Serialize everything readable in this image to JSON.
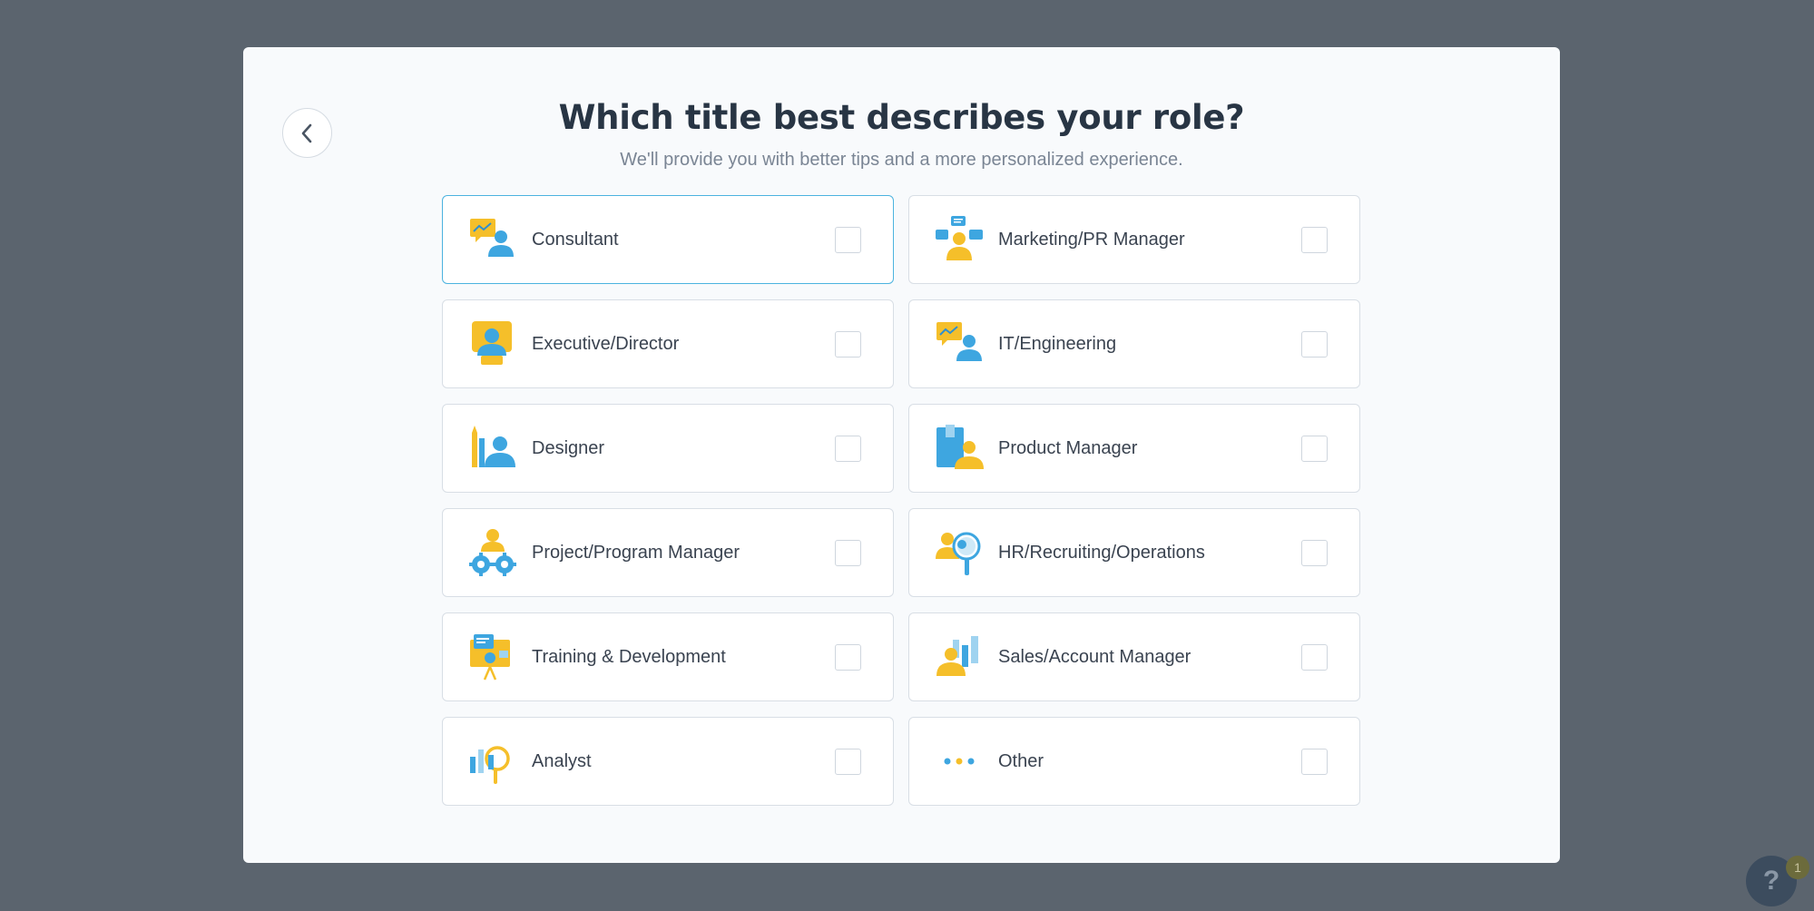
{
  "modal": {
    "title": "Which title best describes your role?",
    "subtitle": "We'll provide you with better tips and a more personalized experience."
  },
  "roles": [
    {
      "label": "Consultant",
      "icon": "consultant-icon",
      "checked": false
    },
    {
      "label": "Marketing/PR Manager",
      "icon": "marketing-icon",
      "checked": false
    },
    {
      "label": "Executive/Director",
      "icon": "executive-icon",
      "checked": false
    },
    {
      "label": "IT/Engineering",
      "icon": "engineering-icon",
      "checked": false
    },
    {
      "label": "Designer",
      "icon": "designer-icon",
      "checked": false
    },
    {
      "label": "Product Manager",
      "icon": "product-manager-icon",
      "checked": false
    },
    {
      "label": "Project/Program Manager",
      "icon": "project-manager-icon",
      "checked": false
    },
    {
      "label": "HR/Recruiting/Operations",
      "icon": "hr-icon",
      "checked": false
    },
    {
      "label": "Training & Development",
      "icon": "training-icon",
      "checked": false
    },
    {
      "label": "Sales/Account Manager",
      "icon": "sales-icon",
      "checked": false
    },
    {
      "label": "Analyst",
      "icon": "analyst-icon",
      "checked": false
    },
    {
      "label": "Other",
      "icon": "more-dots-icon",
      "checked": false
    }
  ],
  "help": {
    "label": "?",
    "badge": "1"
  },
  "colors": {
    "accent_blue": "#3ea6e0",
    "accent_yellow": "#f5bf2a",
    "selected_border": "#4cb3df"
  }
}
